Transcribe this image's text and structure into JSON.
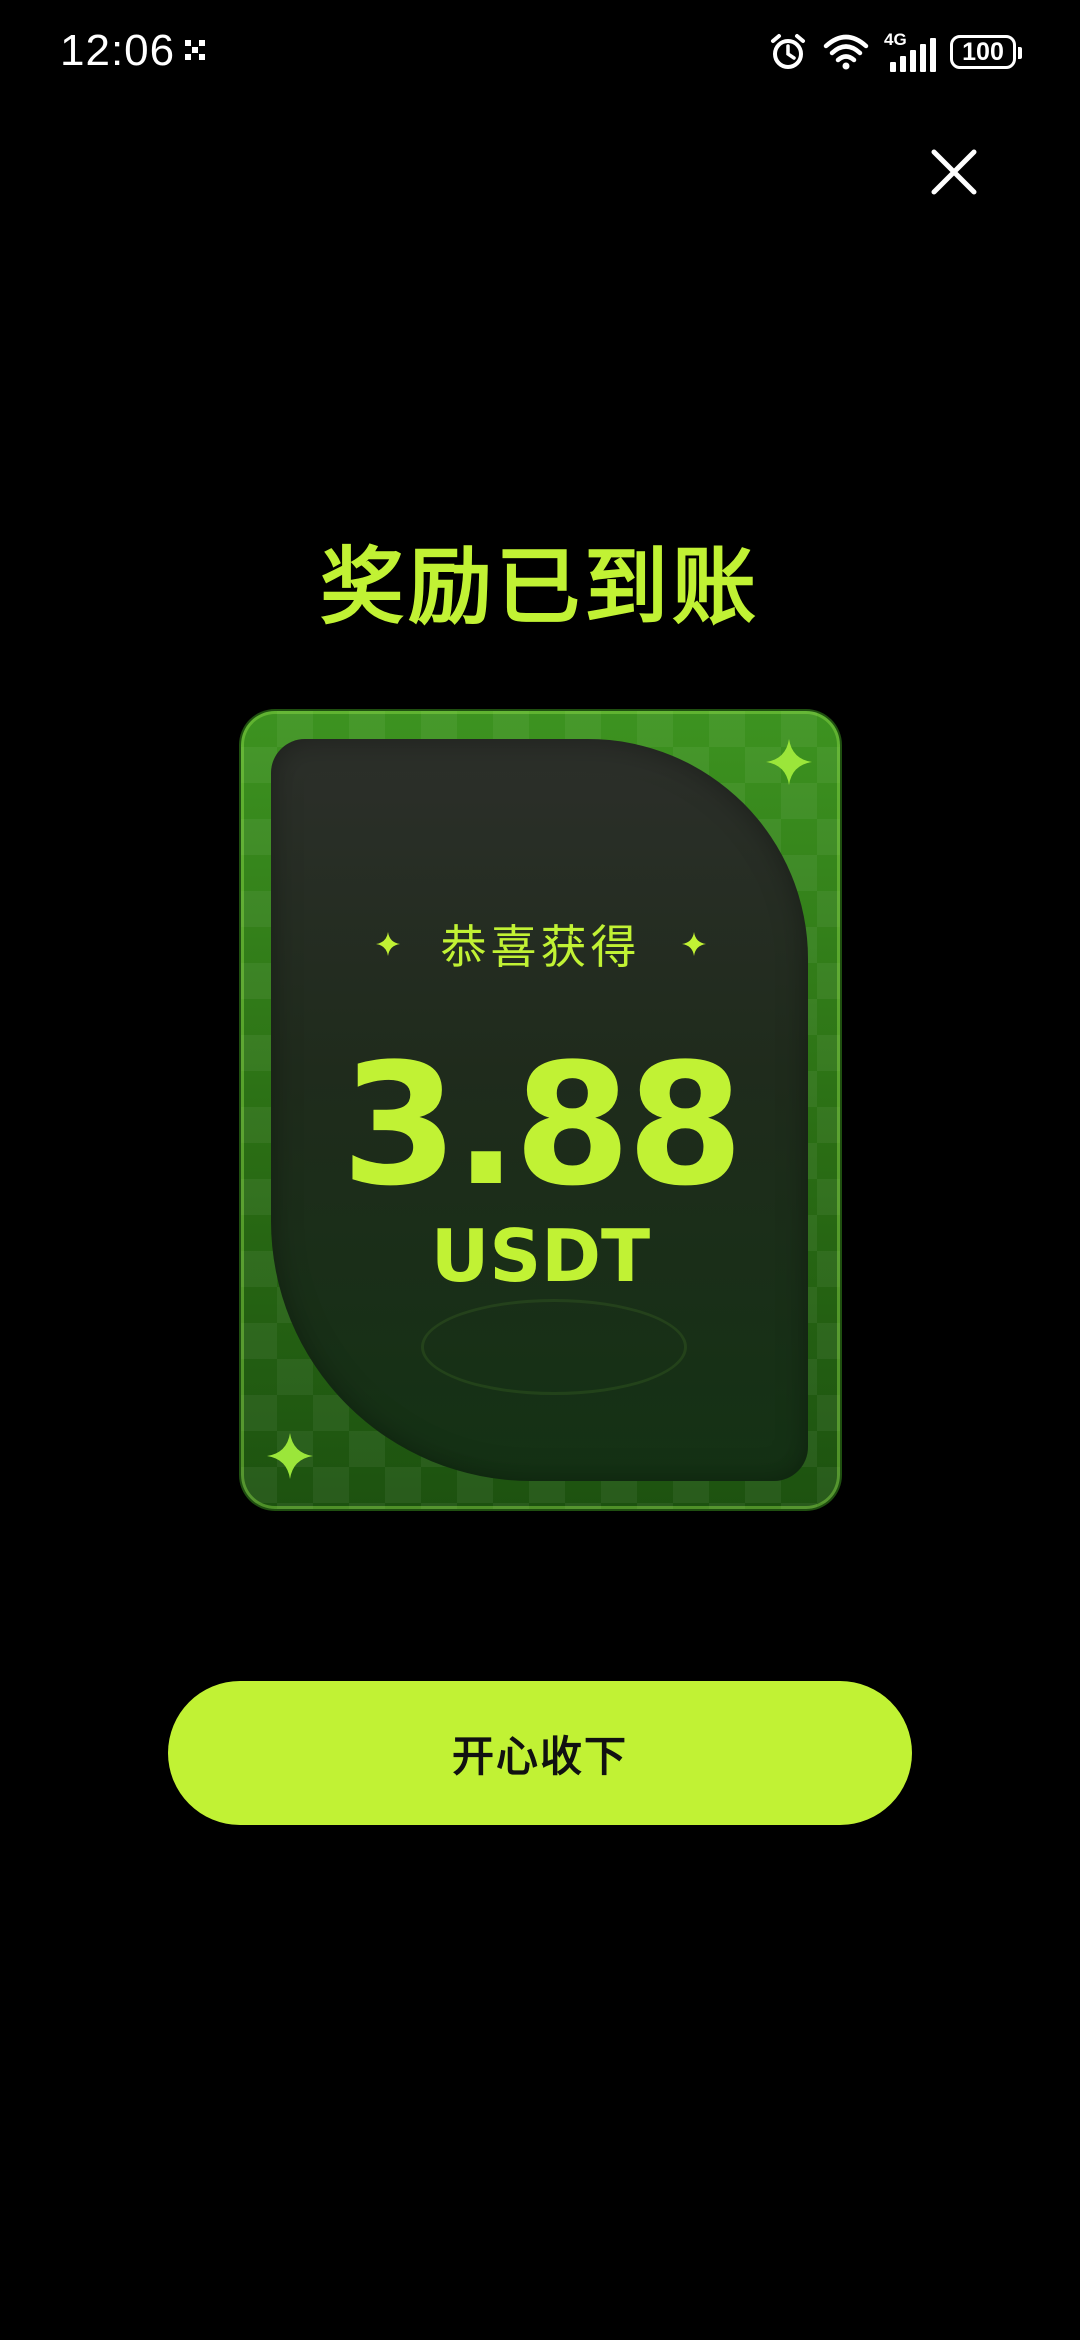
{
  "status_bar": {
    "time": "12:06",
    "network": "4G",
    "battery": "100"
  },
  "dialog": {
    "title": "奖励已到账",
    "congrats_label": "恭喜获得",
    "amount": "3.88",
    "unit": "USDT",
    "accept_label": "开心收下"
  },
  "colors": {
    "accent": "#c1f234",
    "background": "#000000",
    "card_green": "#2a6d14"
  },
  "icons": {
    "close": "close-icon",
    "sparkle": "sparkle-icon",
    "alarm": "alarm-icon",
    "wifi": "wifi-icon",
    "signal": "signal-icon",
    "battery": "battery-icon"
  }
}
